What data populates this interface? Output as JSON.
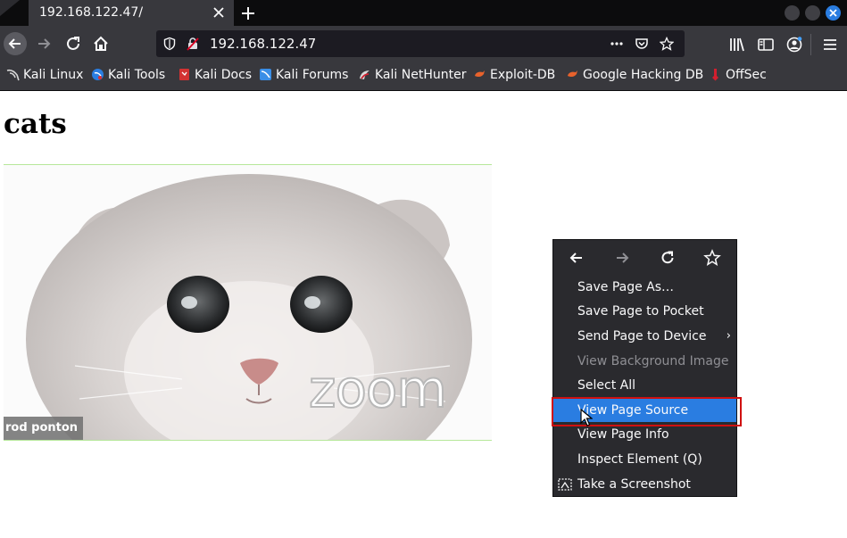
{
  "browser": {
    "tab": {
      "title": "192.168.122.47/"
    },
    "url": "192.168.122.47",
    "bookmarks": [
      {
        "label": "Kali Linux",
        "icon": "kali-dragon-icon"
      },
      {
        "label": "Kali Tools",
        "icon": "kali-tools-icon"
      },
      {
        "label": "Kali Docs",
        "icon": "kali-docs-icon"
      },
      {
        "label": "Kali Forums",
        "icon": "kali-forums-icon"
      },
      {
        "label": "Kali NetHunter",
        "icon": "nethunter-icon"
      },
      {
        "label": "Exploit-DB",
        "icon": "exploit-db-icon"
      },
      {
        "label": "Google Hacking DB",
        "icon": "ghdb-icon"
      },
      {
        "label": "OffSec",
        "icon": "offsec-icon"
      }
    ]
  },
  "page": {
    "heading": "cats",
    "image": {
      "name_tag": "rod ponton",
      "watermark": "zoom"
    }
  },
  "context_menu": {
    "items": [
      {
        "label": "Save Page As…",
        "state": "enabled"
      },
      {
        "label": "Save Page to Pocket",
        "state": "enabled"
      },
      {
        "label": "Send Page to Device",
        "state": "enabled",
        "submenu": "›"
      },
      {
        "label": "View Background Image",
        "state": "disabled"
      },
      {
        "label": "Select All",
        "state": "enabled"
      },
      {
        "label": "View Page Source",
        "state": "active"
      },
      {
        "label": "View Page Info",
        "state": "enabled"
      },
      {
        "label": "Inspect Element (Q)",
        "state": "enabled"
      },
      {
        "label": "Take a Screenshot",
        "state": "enabled",
        "icon": "screenshot-icon"
      }
    ]
  },
  "colors": {
    "chrome_dark": "#0c0c0d",
    "toolbar": "#38383d",
    "menu_bg": "#2a2a2e",
    "accent": "#2a7de1",
    "annotation": "#d01010"
  }
}
